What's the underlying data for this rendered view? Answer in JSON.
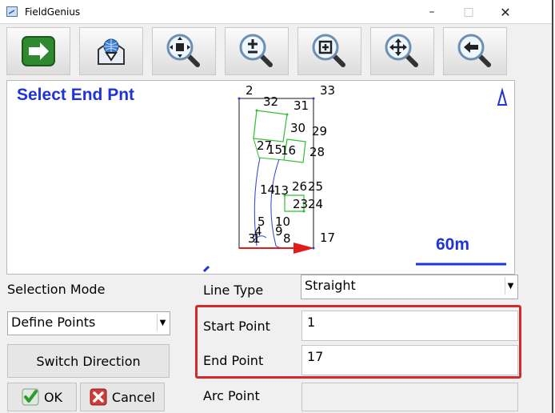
{
  "window": {
    "title": "FieldGenius"
  },
  "titlebar_controls": {
    "minimize": "–",
    "maximize": "□",
    "close": "✕"
  },
  "toolbar": [
    {
      "name": "next-arrow-icon"
    },
    {
      "name": "download-icon"
    },
    {
      "name": "zoom-extents-icon"
    },
    {
      "name": "zoom-in-out-icon"
    },
    {
      "name": "zoom-window-icon"
    },
    {
      "name": "pan-icon"
    },
    {
      "name": "zoom-previous-icon"
    }
  ],
  "map": {
    "prompt": "Select End Pnt",
    "scale_label": "60m",
    "point_labels": [
      "2",
      "33",
      "32",
      "31",
      "30",
      "29",
      "27",
      "15",
      "16",
      "28",
      "14",
      "13",
      "26",
      "25",
      "23",
      "24",
      "5",
      "10",
      "4",
      "9",
      "3",
      "1",
      "8",
      "17"
    ]
  },
  "form": {
    "selection_mode_label": "Selection Mode",
    "selection_mode_value": "Define Points",
    "line_type_label": "Line Type",
    "line_type_value": "Straight",
    "start_point_label": "Start Point",
    "start_point_value": "1",
    "end_point_label": "End Point",
    "end_point_value": "17",
    "arc_point_label": "Arc Point",
    "arc_point_value": "",
    "switch_direction_label": "Switch Direction",
    "ok_label": "OK",
    "cancel_label": "Cancel"
  },
  "colors": {
    "prompt_blue": "#1f33d6",
    "highlight_red": "#d32b2b",
    "lot_green": "#2ec02e",
    "road_blue": "#2b3fd0"
  }
}
